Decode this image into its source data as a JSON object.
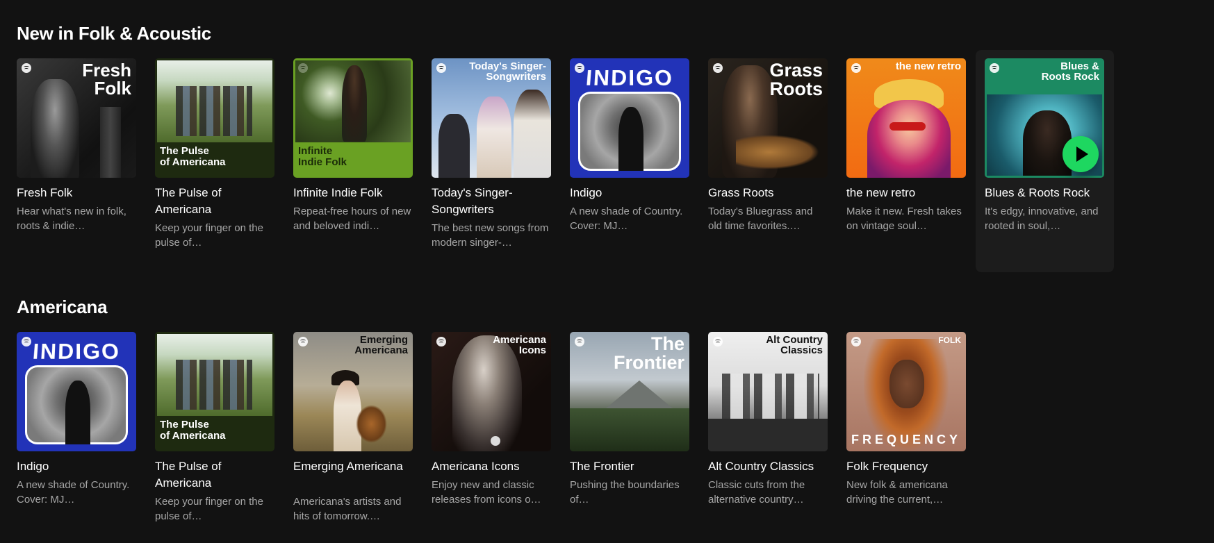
{
  "sections": [
    {
      "title": "New in Folk & Acoustic",
      "cards": [
        {
          "title": "Fresh Folk",
          "desc": "Hear what's new in folk, roots & indie…",
          "cover_text": "Fresh\nFolk"
        },
        {
          "title": "The Pulse of Americana",
          "desc": "Keep your finger on the pulse of…",
          "cover_text": "The Pulse\nof Americana"
        },
        {
          "title": "Infinite Indie Folk",
          "desc": "Repeat-free hours of new and beloved indi…",
          "cover_text": "Infinite\nIndie Folk"
        },
        {
          "title": "Today's Singer-Songwriters",
          "desc": "The best new songs from modern singer-…",
          "cover_text": "Today's Singer-\nSongwriters"
        },
        {
          "title": "Indigo",
          "desc": "A new shade of Country. Cover: MJ…",
          "cover_text": "INDIGO"
        },
        {
          "title": "Grass Roots",
          "desc": "Today's Bluegrass and old time favorites.…",
          "cover_text": "Grass\nRoots"
        },
        {
          "title": "the new retro",
          "desc": "Make it new. Fresh takes on vintage soul…",
          "cover_text": "the new retro"
        },
        {
          "title": "Blues & Roots Rock",
          "desc": "It's edgy, innovative, and rooted in soul,…",
          "cover_text": "Blues &\nRoots Rock"
        }
      ]
    },
    {
      "title": "Americana",
      "cards": [
        {
          "title": "Indigo",
          "desc": "A new shade of Country. Cover: MJ…",
          "cover_text": "INDIGO"
        },
        {
          "title": "The Pulse of Americana",
          "desc": "Keep your finger on the pulse of…",
          "cover_text": "The Pulse\nof Americana"
        },
        {
          "title": "Emerging Americana",
          "desc": "Americana's artists and hits of tomorrow.…",
          "cover_text": "Emerging\nAmericana"
        },
        {
          "title": "Americana Icons",
          "desc": "Enjoy new and classic releases from icons o…",
          "cover_text": "Americana\nIcons"
        },
        {
          "title": "The Frontier",
          "desc": "Pushing the boundaries of…",
          "cover_text": "The\nFrontier"
        },
        {
          "title": "Alt Country Classics",
          "desc": "Classic cuts from the alternative country…",
          "cover_text": "Alt Country\nClassics"
        },
        {
          "title": "Folk Frequency",
          "desc": "New folk & americana driving the current,…",
          "cover_text": "FOLK",
          "cover_text_2": "FREQUENCY"
        }
      ]
    }
  ],
  "colors": {
    "background": "#121212",
    "accent_green": "#1ed760",
    "subtext": "#a7a7a7"
  }
}
